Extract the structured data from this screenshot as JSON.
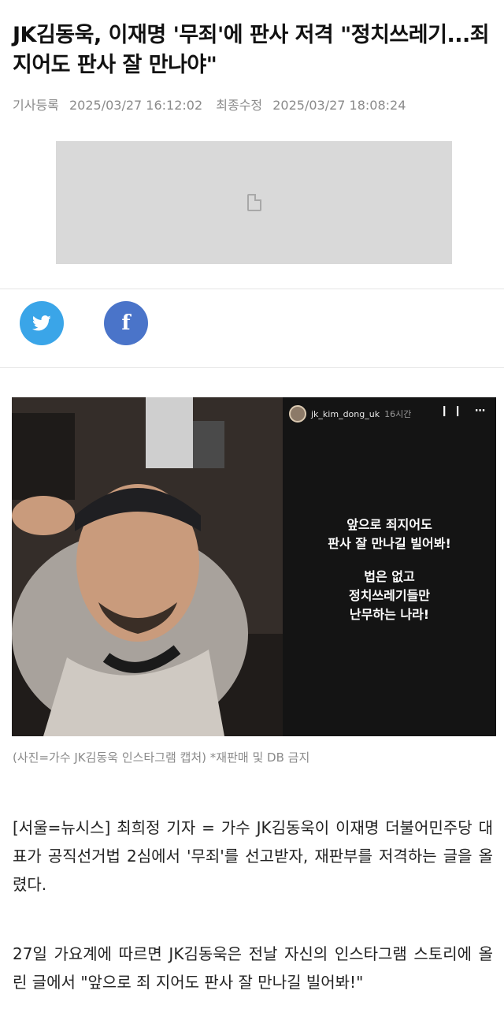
{
  "article": {
    "title": "JK김동욱, 이재명 '무죄'에 판사 저격 \"정치쓰레기...죄지어도 판사 잘 만나야\"",
    "registered_label": "기사등록",
    "registered_time": "2025/03/27  16:12:02",
    "modified_label": "최종수정",
    "modified_time": "2025/03/27  18:08:24"
  },
  "share": {
    "twitter_icon": "twitter-icon",
    "facebook_icon": "facebook-icon",
    "twitter_color": "#3aa5e8",
    "facebook_color": "#4a74c9"
  },
  "photo": {
    "story_username": "jk_kim_dong_uk",
    "story_time": "16시간",
    "story_lines_1": [
      "앞으로 죄지어도",
      "판사 잘 만나길 빌어봐!"
    ],
    "story_lines_2": [
      "법은 없고",
      "정치쓰레기들만",
      "난무하는 나라!"
    ],
    "caption": "(사진=가수 JK김동욱 인스타그램 캡처) *재판매 및 DB 금지"
  },
  "body": {
    "paragraph_1": "[서울=뉴시스] 최희정 기자 = 가수 JK김동욱이 이재명 더불어민주당 대표가 공직선거법 2심에서 '무죄'를 선고받자, 재판부를 저격하는 글을 올렸다.",
    "paragraph_2": "27일 가요계에 따르면 JK김동욱은 전날 자신의 인스타그램 스토리에 올린 글에서 \"앞으로 죄 지어도 판사 잘 만나길 빌어봐!\""
  }
}
